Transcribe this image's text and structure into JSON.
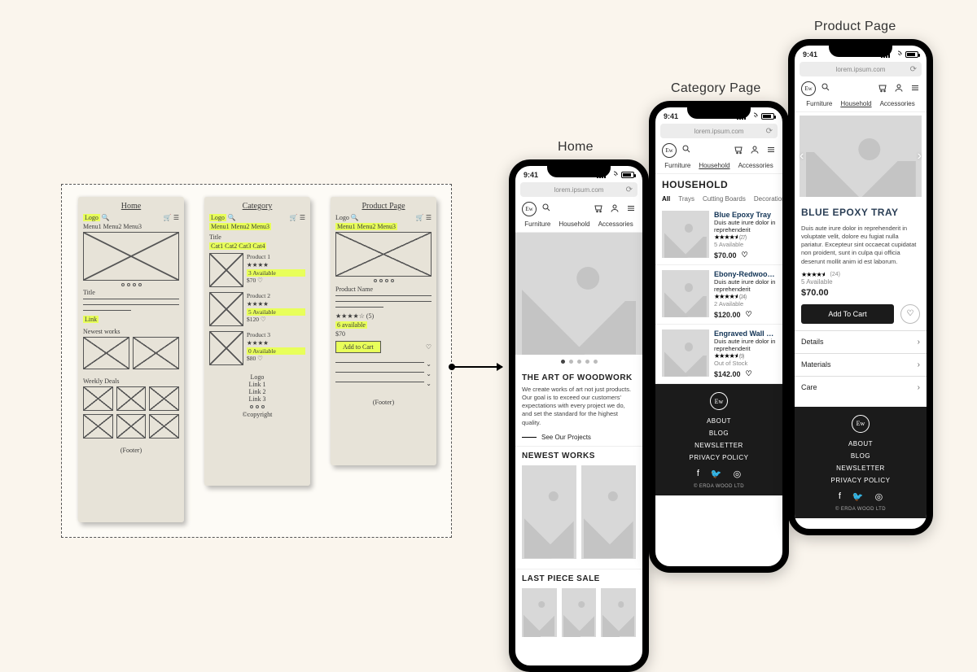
{
  "labels": {
    "home": "Home",
    "category": "Category Page",
    "product": "Product Page"
  },
  "sketches": {
    "home_title": "Home",
    "category_title": "Category",
    "product_title": "Product Page",
    "home": {
      "logo": "Logo",
      "menus": "Menu1 Menu2 Menu3",
      "title": "Title",
      "link": "Link",
      "newest": "Newest works",
      "weekly": "Weekly Deals",
      "footer": "(Footer)"
    },
    "cat": {
      "logo": "Logo",
      "menus": "Menu1 Menu2 Menu3",
      "title": "Title",
      "cats": "Cat1 Cat2 Cat3 Cat4",
      "p1": "Product 1",
      "p1b": "3 Available",
      "p1c": "$70  ♡",
      "p2": "Product 2",
      "p2b": "5 Available",
      "p2c": "$120 ♡",
      "p3": "Product 3",
      "p3b": "0 Available",
      "p3c": "$80 ♡",
      "flogo": "Logo",
      "l1": "Link 1",
      "l2": "Link 2",
      "l3": "Link 3",
      "cp": "©copyright"
    },
    "prod": {
      "logo": "Logo",
      "menus": "Menu1 Menu2 Menu3",
      "name": "Product Name",
      "rating": "★★★★☆ (5)",
      "avail": "6 available",
      "price": "$70",
      "add": "Add to Cart",
      "heart": "♡",
      "footer": "(Footer)"
    }
  },
  "common": {
    "time": "9:41",
    "url": "lorem.ipsum.com",
    "categories": [
      "Furniture",
      "Household",
      "Accessories"
    ]
  },
  "home": {
    "hero_title": "THE ART OF WOODWORK",
    "hero_body": "We create works of art not just products. Our goal is to exceed our customers' expectations with every project we do, and set the standard for the highest quality.",
    "hero_link": "See Our Projects",
    "newest": "NEWEST WORKS",
    "sale": "LAST PIECE SALE"
  },
  "category": {
    "title": "HOUSEHOLD",
    "tabs": [
      "All",
      "Trays",
      "Cutting Boards",
      "Decoration"
    ],
    "products": [
      {
        "name": "Blue Epoxy Tray",
        "desc": "Duis aute irure dolor in reprehenderit",
        "rating": 4.5,
        "count": 27,
        "avail": "5 Available",
        "price": "$70.00"
      },
      {
        "name": "Ebony-Redwood Cutting Board",
        "desc": "Duis aute irure dolor in reprehenderit",
        "rating": 4.5,
        "count": 24,
        "avail": "2 Available",
        "price": "$120.00"
      },
      {
        "name": "Engraved Wall Crest",
        "desc": "Duis aute irure dolor in reprehenderit",
        "rating": 4.5,
        "count": 9,
        "avail": "Out of Stock",
        "price": "$142.00"
      }
    ]
  },
  "product": {
    "name": "BLUE EPOXY TRAY",
    "desc": "Duis aute irure dolor in reprehenderit in voluptate velit, dolore eu fugiat nulla pariatur. Excepteur sint occaecat cupidatat non proident, sunt in culpa qui officia deserunt mollit anim id est laborum.",
    "rating": 4.5,
    "count": 24,
    "avail": "5 Available",
    "price": "$70.00",
    "add": "Add To Cart",
    "acc": [
      "Details",
      "Materials",
      "Care"
    ]
  },
  "footer": {
    "links": [
      "ABOUT",
      "BLOG",
      "NEWSLETTER",
      "PRIVACY POLICY"
    ],
    "copyright": "© ERDA WOOD LTD"
  }
}
